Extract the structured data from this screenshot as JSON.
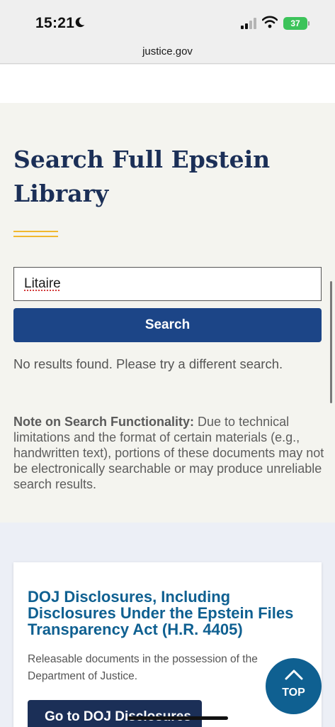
{
  "status_bar": {
    "time": "15:21",
    "battery": "37"
  },
  "browser": {
    "url": "justice.gov"
  },
  "search": {
    "title": "Search Full Epstein Library",
    "query": "Litaire",
    "button_label": "Search",
    "no_results": "No results found. Please try a different search.",
    "note_heading": "Note on Search Functionality:",
    "note_body": " Due to technical limitations and the format of certain materials (e.g., handwritten text), portions of these documents may not be electronically searchable or may produce unreliable search results."
  },
  "disclosures_card": {
    "title": "DOJ Disclosures, Including Disclosures Under the Epstein Files Transparency Act (H.R. 4405)",
    "description": "Releasable documents in the possession of the Department of Justice.",
    "button_label": "Go to DOJ Disclosures"
  },
  "back_to_top": {
    "label": "TOP"
  },
  "colors": {
    "title_navy": "#1b2f57",
    "button_blue": "#1c4587",
    "accent_gold": "#f0b830",
    "link_blue": "#0f6091"
  }
}
